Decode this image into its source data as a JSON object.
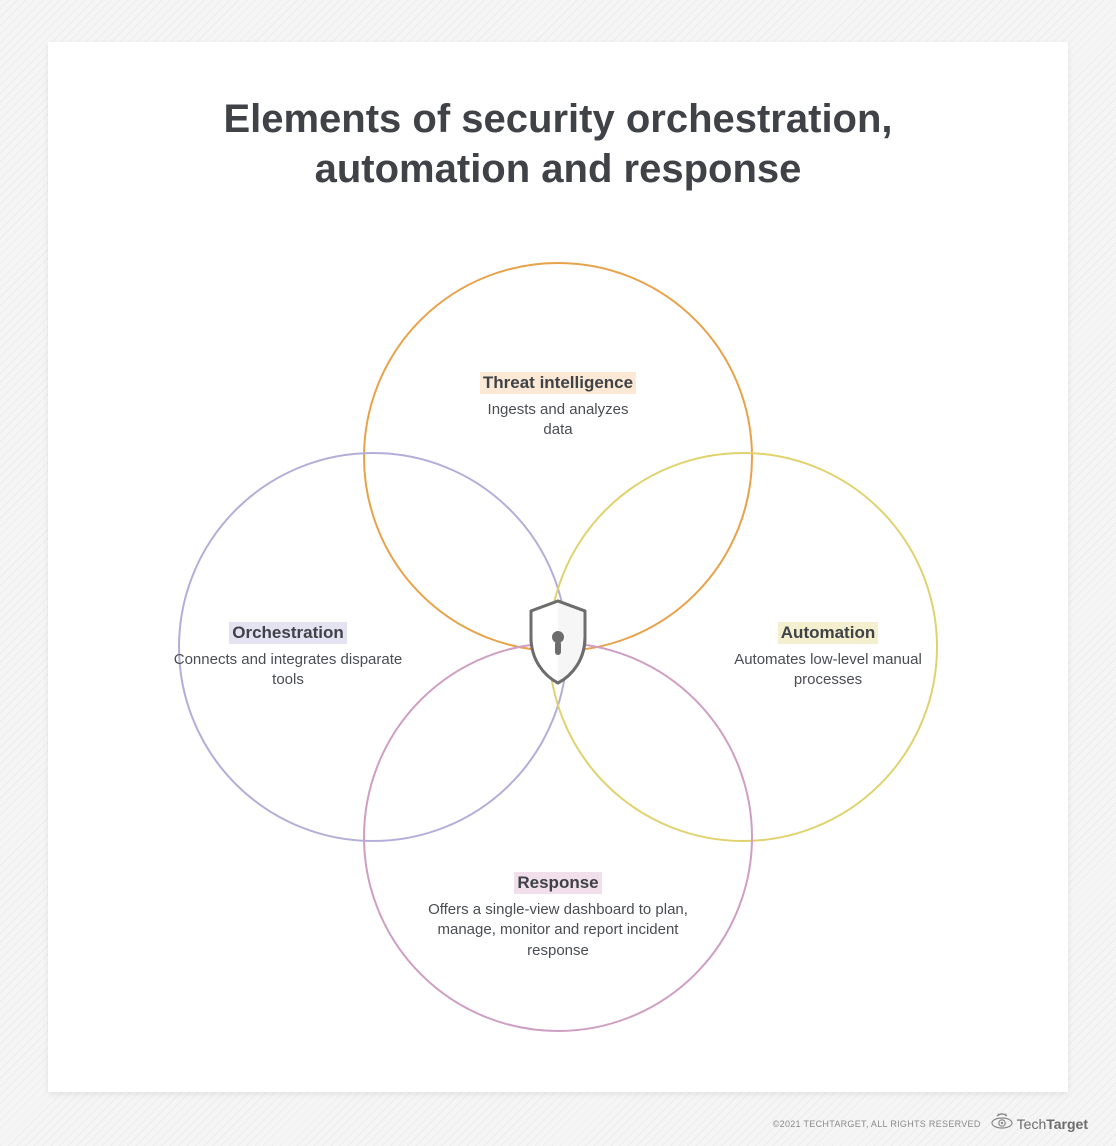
{
  "title": "Elements of security orchestration, automation and response",
  "nodes": {
    "top": {
      "label": "Threat intelligence",
      "desc": "Ingests and analyzes data",
      "color": "#e8a24a",
      "highlight": "hl-orange"
    },
    "left": {
      "label": "Orchestration",
      "desc": "Connects and integrates disparate tools",
      "color": "#b3aed9",
      "highlight": "hl-purple"
    },
    "right": {
      "label": "Automation",
      "desc": "Automates low-level manual processes",
      "color": "#e0d26e",
      "highlight": "hl-yellow"
    },
    "bottom": {
      "label": "Response",
      "desc": "Offers a single-view dashboard to plan, manage, monitor and report incident response",
      "color": "#cf9ec3",
      "highlight": "hl-pink"
    }
  },
  "center_icon": "shield-lock-icon",
  "footer": {
    "copyright": "©2021 TECHTARGET, ALL RIGHTS RESERVED",
    "brand_light": "Tech",
    "brand_bold": "Target"
  }
}
